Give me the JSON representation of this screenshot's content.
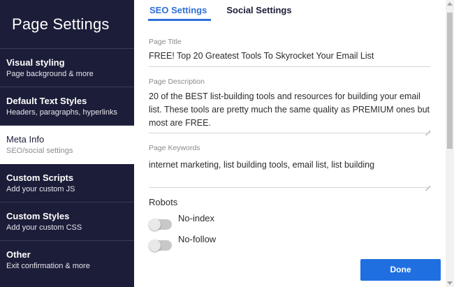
{
  "sidebar": {
    "title": "Page Settings",
    "items": [
      {
        "label": "Visual styling",
        "sub": "Page background & more"
      },
      {
        "label": "Default Text Styles",
        "sub": "Headers, paragraphs, hyperlinks"
      },
      {
        "label": "Meta Info",
        "sub": "SEO/social settings"
      },
      {
        "label": "Custom Scripts",
        "sub": "Add your custom JS"
      },
      {
        "label": "Custom Styles",
        "sub": "Add your custom CSS"
      },
      {
        "label": "Other",
        "sub": "Exit confirmation & more"
      }
    ]
  },
  "tabs": [
    {
      "label": "SEO Settings",
      "active": true
    },
    {
      "label": "Social Settings",
      "active": false
    }
  ],
  "form": {
    "title_label": "Page Title",
    "title_value": "FREE! Top 20 Greatest Tools To Skyrocket Your Email List",
    "description_label": "Page Description",
    "description_value": "20 of the BEST list-building tools and resources for building your email list. These tools are pretty much the same quality as PREMIUM ones but most are FREE.",
    "keywords_label": "Page Keywords",
    "keywords_value": "internet marketing, list building tools, email list, list building",
    "robots_label": "Robots",
    "noindex_label": "No-index",
    "nofollow_label": "No-follow"
  },
  "footer": {
    "done_label": "Done"
  },
  "colors": {
    "sidebar_bg": "#1c1d38",
    "accent": "#2f6fd8",
    "done_button": "#1f6fe0"
  }
}
